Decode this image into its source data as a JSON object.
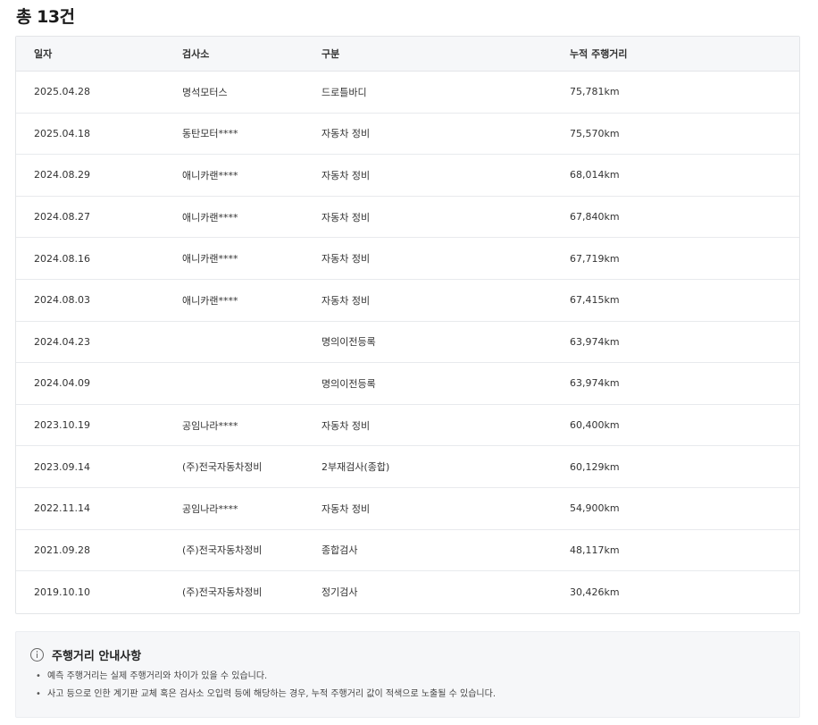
{
  "summary": {
    "total": "총 13건"
  },
  "table": {
    "headers": [
      "일자",
      "검사소",
      "구분",
      "누적 주행거리"
    ],
    "rows": [
      [
        "2025.04.28",
        "명석모터스",
        "드로틀바디",
        "75,781km"
      ],
      [
        "2025.04.18",
        "동탄모터****",
        "자동차 정비",
        "75,570km"
      ],
      [
        "2024.08.29",
        "애니카랜****",
        "자동차 정비",
        "68,014km"
      ],
      [
        "2024.08.27",
        "애니카랜****",
        "자동차 정비",
        "67,840km"
      ],
      [
        "2024.08.16",
        "애니카랜****",
        "자동차 정비",
        "67,719km"
      ],
      [
        "2024.08.03",
        "애니카랜****",
        "자동차 정비",
        "67,415km"
      ],
      [
        "2024.04.23",
        "",
        "명의이전등록",
        "63,974km"
      ],
      [
        "2024.04.09",
        "",
        "명의이전등록",
        "63,974km"
      ],
      [
        "2023.10.19",
        "공임나라****",
        "자동차 정비",
        "60,400km"
      ],
      [
        "2023.09.14",
        "(주)전국자동차정비",
        "2부재검사(종합)",
        "60,129km"
      ],
      [
        "2022.11.14",
        "공임나라****",
        "자동차 정비",
        "54,900km"
      ],
      [
        "2021.09.28",
        "(주)전국자동차정비",
        "종합검사",
        "48,117km"
      ],
      [
        "2019.10.10",
        "(주)전국자동차정비",
        "정기검사",
        "30,426km"
      ]
    ]
  },
  "notice": {
    "icon": "info-icon",
    "title": "주행거리 안내사항",
    "bullet": "•",
    "items": [
      "예측 주행거리는 실제 주행거리와 차이가 있을 수 있습니다.",
      "사고 등으로 인한 계기판 교체 혹은 검사소 오입력 등에 해당하는 경우, 누적 주행거리 값이 적색으로 노출될 수 있습니다."
    ]
  }
}
